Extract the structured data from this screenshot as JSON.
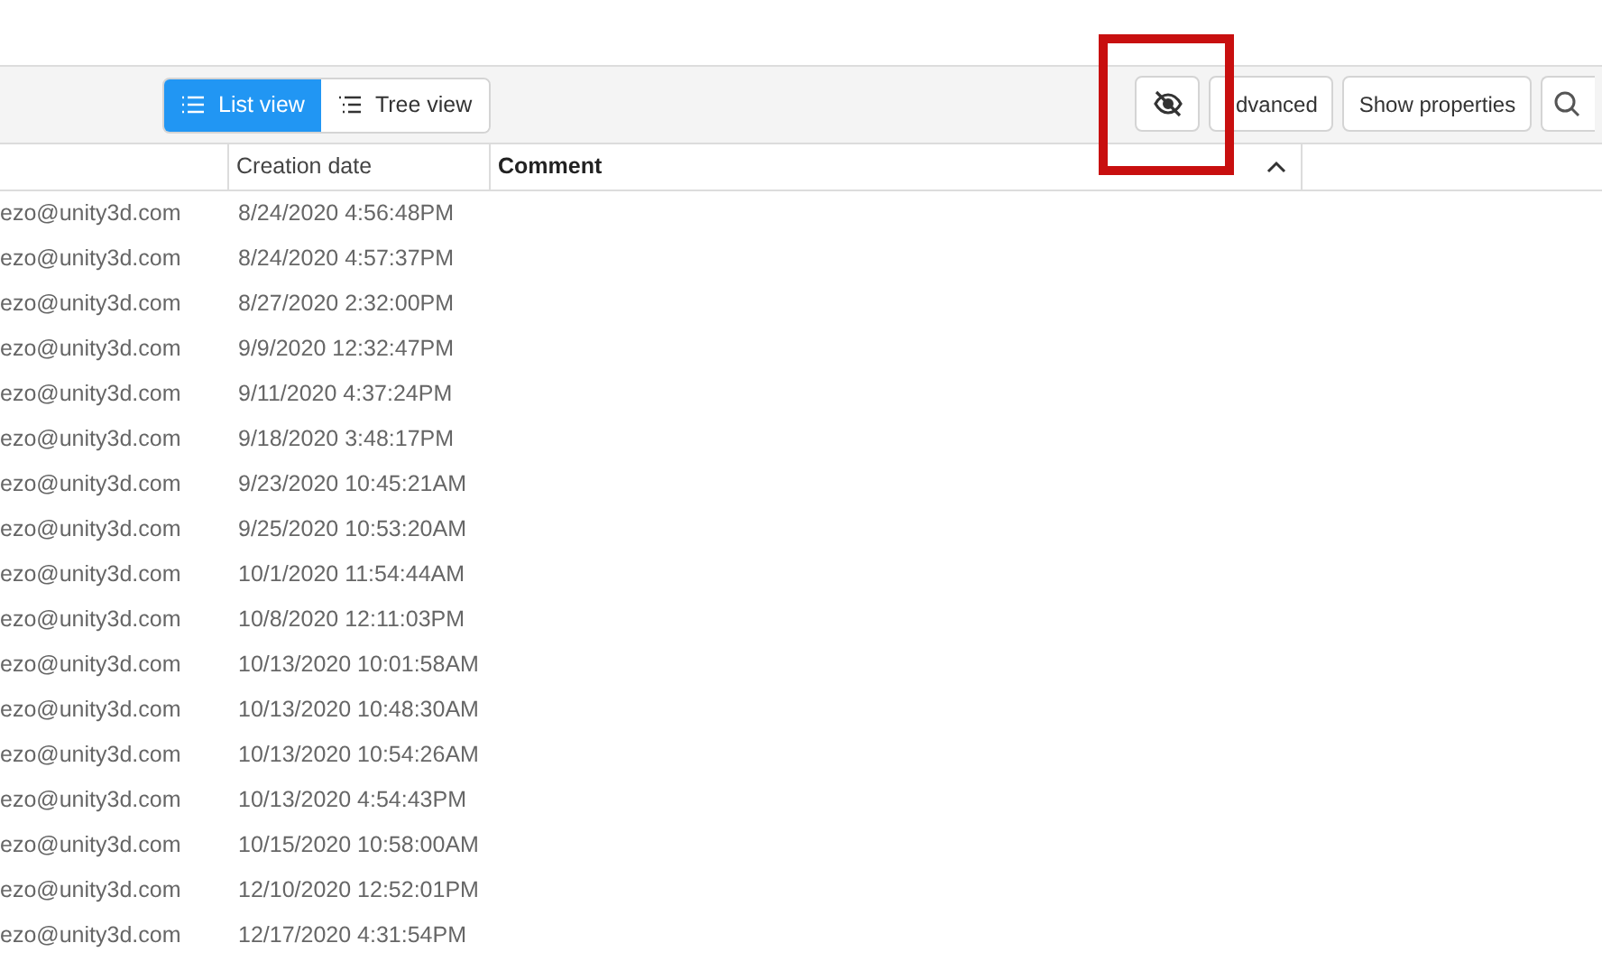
{
  "toolbar": {
    "view_toggle": [
      {
        "label": "List view",
        "kind": "list",
        "selected": true
      },
      {
        "label": "Tree view",
        "kind": "tree",
        "selected": false
      }
    ],
    "visibility_button": {
      "hidden": true,
      "highlighted": true
    },
    "buttons": [
      "dvanced",
      "Show properties"
    ]
  },
  "table": {
    "columns": [
      {
        "sorted": false
      },
      {
        "label": "Creation date",
        "sorted": false
      },
      {
        "label": "Comment",
        "sorted": true
      }
    ],
    "rows": [
      {
        "column_1": "ezo@unity3d.com",
        "creation_date": "8/24/2020 4:56:48PM"
      },
      {
        "column_1": "ezo@unity3d.com",
        "creation_date": "8/24/2020 4:57:37PM"
      },
      {
        "column_1": "ezo@unity3d.com",
        "creation_date": "8/27/2020 2:32:00PM"
      },
      {
        "column_1": "ezo@unity3d.com",
        "creation_date": "9/9/2020 12:32:47PM"
      },
      {
        "column_1": "ezo@unity3d.com",
        "creation_date": "9/11/2020 4:37:24PM"
      },
      {
        "column_1": "ezo@unity3d.com",
        "creation_date": "9/18/2020 3:48:17PM"
      },
      {
        "column_1": "ezo@unity3d.com",
        "creation_date": "9/23/2020 10:45:21AM"
      },
      {
        "column_1": "ezo@unity3d.com",
        "creation_date": "9/25/2020 10:53:20AM"
      },
      {
        "column_1": "ezo@unity3d.com",
        "creation_date": "10/1/2020 11:54:44AM"
      },
      {
        "column_1": "ezo@unity3d.com",
        "creation_date": "10/8/2020 12:11:03PM"
      },
      {
        "column_1": "ezo@unity3d.com",
        "creation_date": "10/13/2020 10:01:58AM"
      },
      {
        "column_1": "ezo@unity3d.com",
        "creation_date": "10/13/2020 10:48:30AM"
      },
      {
        "column_1": "ezo@unity3d.com",
        "creation_date": "10/13/2020 10:54:26AM"
      },
      {
        "column_1": "ezo@unity3d.com",
        "creation_date": "10/13/2020 4:54:43PM"
      },
      {
        "column_1": "ezo@unity3d.com",
        "creation_date": "10/15/2020 10:58:00AM"
      },
      {
        "column_1": "ezo@unity3d.com",
        "creation_date": "12/10/2020 12:52:01PM"
      },
      {
        "column_1": "ezo@unity3d.com",
        "creation_date": "12/17/2020 4:31:54PM"
      }
    ]
  }
}
